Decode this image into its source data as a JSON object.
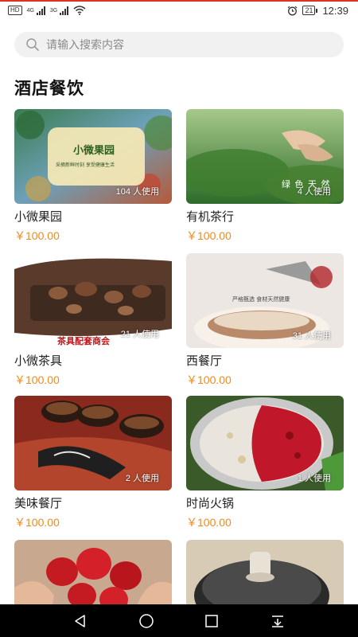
{
  "status_bar": {
    "left_chip": "HD",
    "network_1": "4G",
    "network_2": "3G",
    "battery": "21",
    "time": "12:39"
  },
  "search": {
    "placeholder": "请输入搜索内容"
  },
  "section": {
    "title": "酒店餐饮"
  },
  "items": [
    {
      "name": "小微果园",
      "price": "￥100.00",
      "usage": "104 人使用",
      "thumb_title": "小微果园",
      "thumb_sub": "采摘新鲜时刻 享受健康生活"
    },
    {
      "name": "有机茶行",
      "price": "￥100.00",
      "usage": "4 人使用",
      "thumb_title": "绿 色 天 然"
    },
    {
      "name": "小微茶具",
      "price": "￥100.00",
      "usage": "21 人使用",
      "thumb_title": "茶具配套商会"
    },
    {
      "name": "西餐厅",
      "price": "￥100.00",
      "usage": "31 人使用",
      "thumb_title": "严格甄选  食材天然健康"
    },
    {
      "name": "美味餐厅",
      "price": "￥100.00",
      "usage": "2 人使用"
    },
    {
      "name": "时尚火锅",
      "price": "￥100.00",
      "usage": "1 人使用"
    },
    {
      "name": "",
      "price": "",
      "usage": ""
    },
    {
      "name": "",
      "price": "",
      "usage": ""
    }
  ],
  "colors": {
    "accent_price": "#f08a1e",
    "status_line": "#e0302a",
    "navbar": "#000000"
  },
  "nav_bar": {
    "icons": [
      "back-icon",
      "home-icon",
      "recents-icon",
      "notifications-pull-icon"
    ]
  }
}
